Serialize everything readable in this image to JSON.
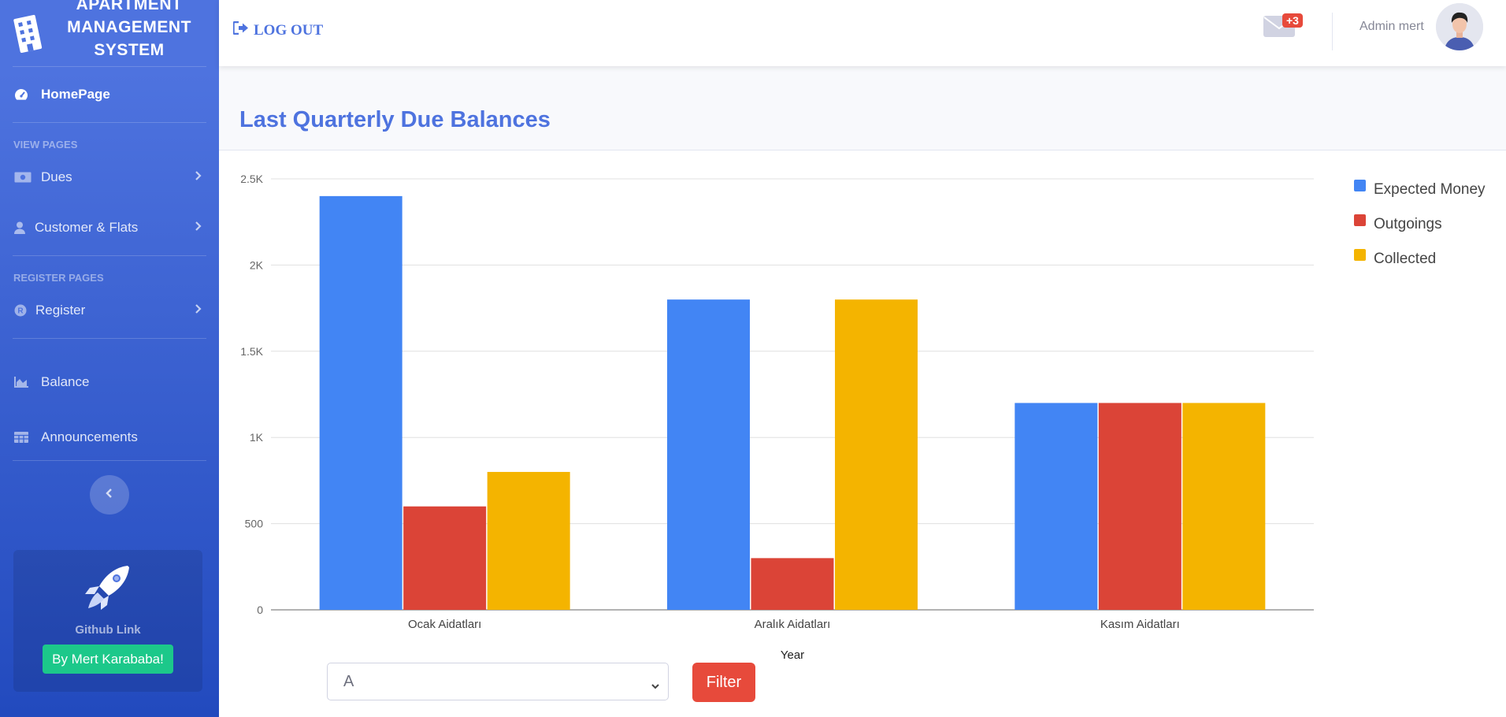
{
  "brand": {
    "line1": "APARTMENT",
    "line2": "MANAGEMENT",
    "line3": "SYSTEM"
  },
  "sidebar": {
    "home": "HomePage",
    "heading_view": "VIEW PAGES",
    "dues": "Dues",
    "customers": "Customer & Flats",
    "heading_register": "REGISTER PAGES",
    "register": "Register",
    "balance": "Balance",
    "announcements": "Announcements",
    "promo_link": "Github Link",
    "promo_button": "By Mert Karababa!"
  },
  "topbar": {
    "logout": "LOG OUT",
    "mail_badge": "+3",
    "user_name": "Admin mert"
  },
  "card": {
    "title": "Last Quarterly Due Balances"
  },
  "filter": {
    "selected": "A",
    "button": "Filter"
  },
  "colors": {
    "expected": "#4285f4",
    "outgoings": "#db4437",
    "collected": "#f4b400",
    "accent": "#4e73df"
  },
  "chart_data": {
    "type": "bar",
    "categories": [
      "Ocak Aidatları",
      "Aralık Aidatları",
      "Kasım Aidatları"
    ],
    "series": [
      {
        "name": "Expected Money",
        "color": "#4285f4",
        "values": [
          2400,
          1800,
          1200
        ]
      },
      {
        "name": "Outgoings",
        "color": "#db4437",
        "values": [
          600,
          300,
          1200
        ]
      },
      {
        "name": "Collected",
        "color": "#f4b400",
        "values": [
          800,
          1800,
          1200
        ]
      }
    ],
    "yticks": [
      "0",
      "500",
      "1K",
      "1.5K",
      "2K",
      "2.5K"
    ],
    "ylim": [
      0,
      2500
    ],
    "xlabel": "Year",
    "ylabel": "",
    "legend_position": "right",
    "grid": true
  }
}
